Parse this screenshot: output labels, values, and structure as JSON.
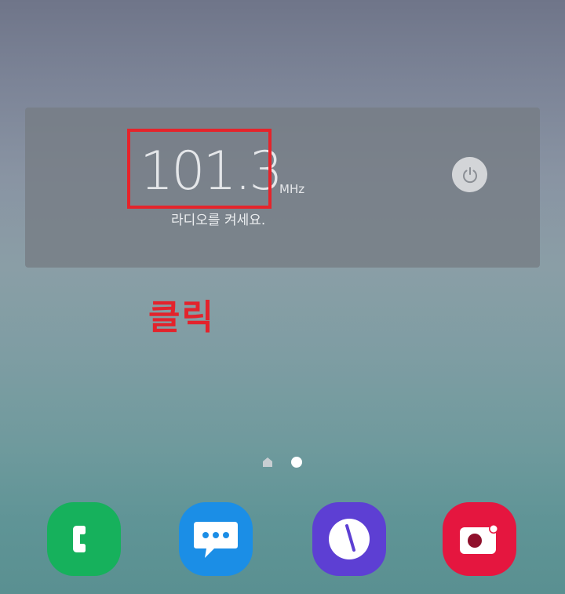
{
  "radio_widget": {
    "frequency": "101.3",
    "unit": "MHz",
    "status_text": "라디오를 켜세요."
  },
  "annotation": {
    "text": "클릭",
    "color": "#e5242b"
  },
  "page_indicator": {
    "pages": [
      "home",
      "page-1"
    ],
    "current_page": 2
  },
  "dock": {
    "apps": [
      {
        "name": "phone",
        "icon": "phone-icon",
        "color": "#16b15c"
      },
      {
        "name": "messages",
        "icon": "message-bubble-icon",
        "color": "#1b8ee6"
      },
      {
        "name": "clock",
        "icon": "clock-icon",
        "color": "#5d3fd3"
      },
      {
        "name": "camera",
        "icon": "camera-icon",
        "color": "#e5163f"
      }
    ]
  }
}
